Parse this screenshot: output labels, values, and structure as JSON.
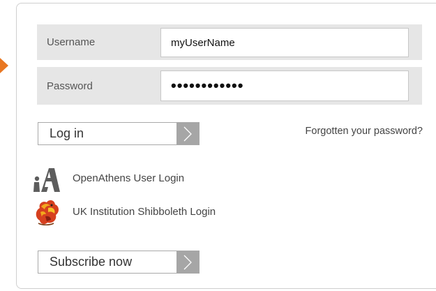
{
  "login_form": {
    "username": {
      "label": "Username",
      "value": "myUserName"
    },
    "password": {
      "label": "Password",
      "value": "••••••••••••"
    },
    "login_button": "Log in",
    "forgot_password": "Forgotten your password?"
  },
  "alternate_logins": [
    {
      "label": "OpenAthens User Login",
      "icon": "openathens-logo"
    },
    {
      "label": "UK Institution Shibboleth Login",
      "icon": "shibboleth-griffin-logo"
    }
  ],
  "subscribe_button": "Subscribe now",
  "colors": {
    "accent_arrow": "#e87722",
    "field_background": "#e6e6e6",
    "chevron_block": "#a6a6a6"
  }
}
